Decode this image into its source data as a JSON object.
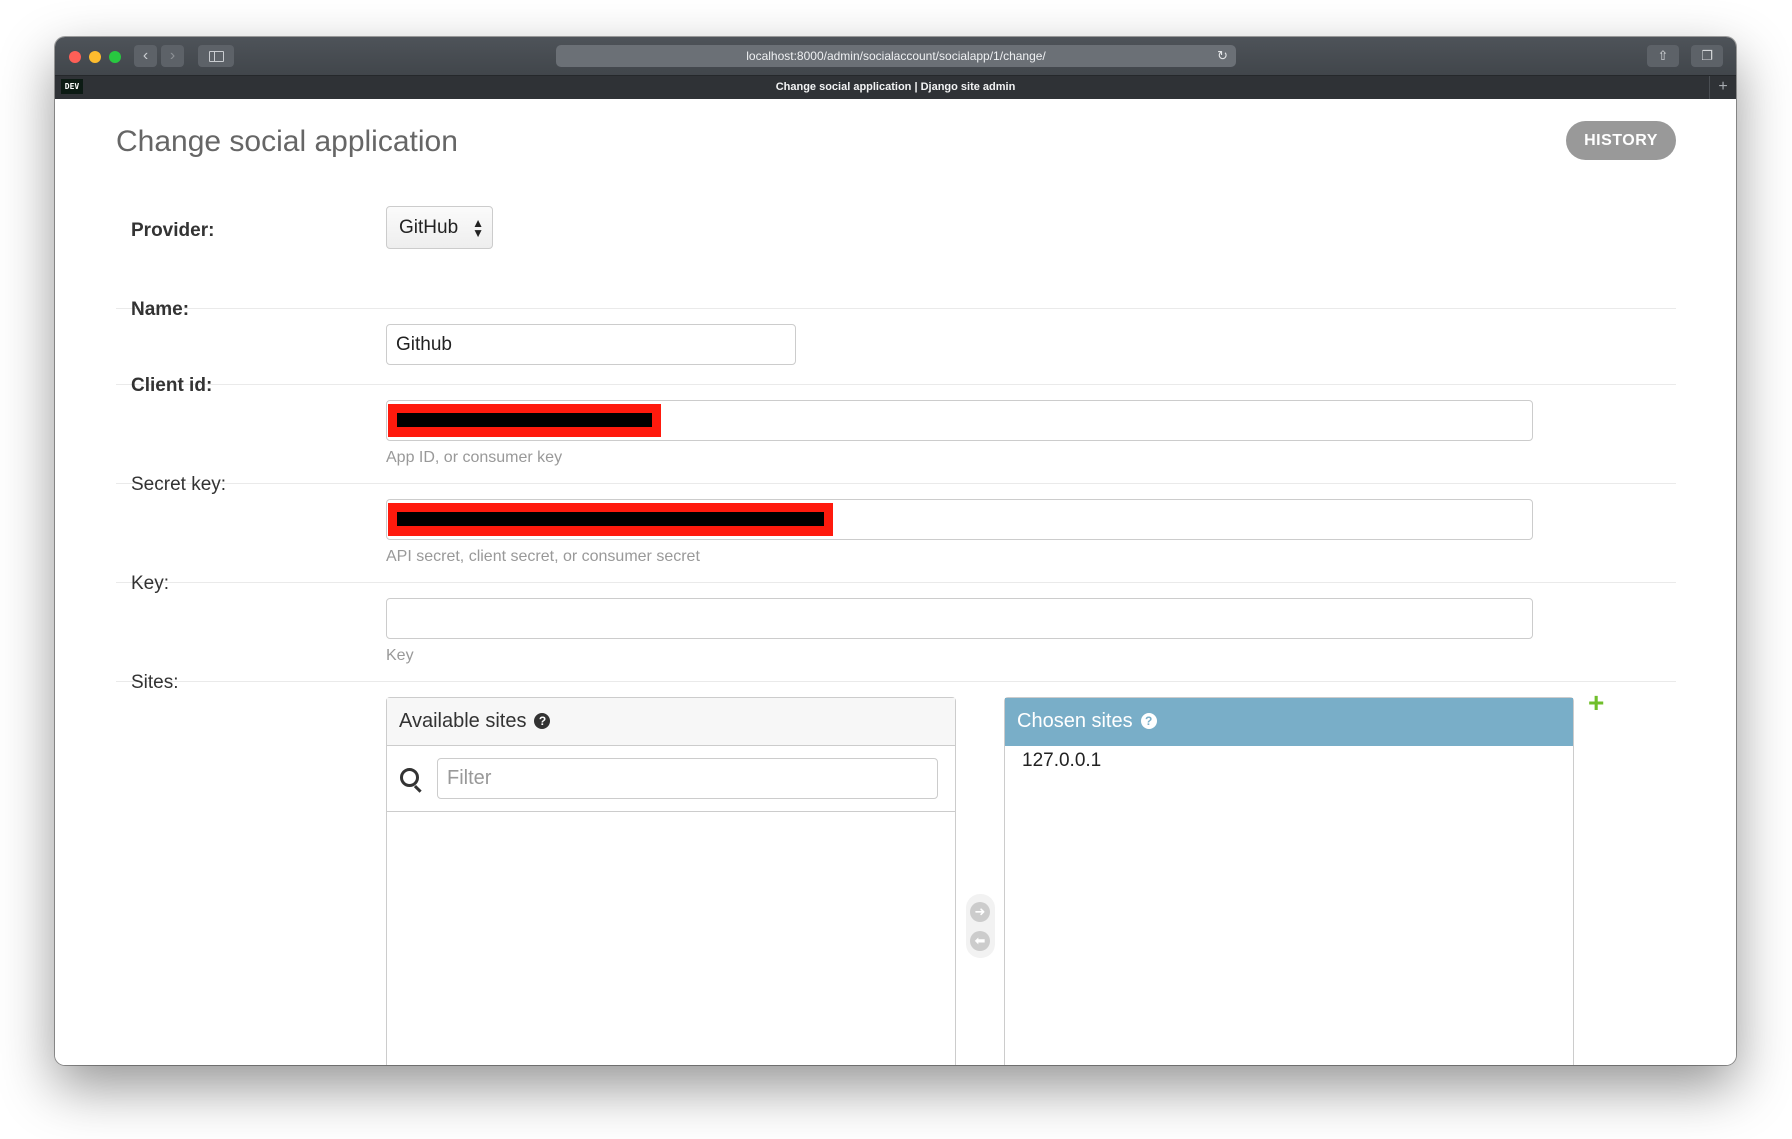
{
  "browser": {
    "url": "localhost:8000/admin/socialaccount/socialapp/1/change/",
    "tab_title": "Change social application | Django site admin",
    "favicon_text": "DEV"
  },
  "page": {
    "title": "Change social application",
    "history_label": "HISTORY"
  },
  "form": {
    "provider": {
      "label": "Provider:",
      "value": "GitHub"
    },
    "name": {
      "label": "Name:",
      "value": "Github"
    },
    "client_id": {
      "label": "Client id:",
      "help": "App ID, or consumer key"
    },
    "secret_key": {
      "label": "Secret key:",
      "help": "API secret, client secret, or consumer secret"
    },
    "key": {
      "label": "Key:",
      "value": "",
      "help": "Key"
    },
    "sites": {
      "label": "Sites:",
      "available_title": "Available sites",
      "filter_placeholder": "Filter",
      "chosen_title": "Chosen sites",
      "chosen_options": [
        "127.0.0.1"
      ]
    }
  },
  "icons": {
    "help": "?",
    "add": "+",
    "choose": "➜",
    "remove": "⬅"
  },
  "colors": {
    "chosen_header": "#79aec8",
    "add_related": "#70bf2b",
    "redaction_outer": "#ff1a0d",
    "redaction_inner": "#000000"
  }
}
